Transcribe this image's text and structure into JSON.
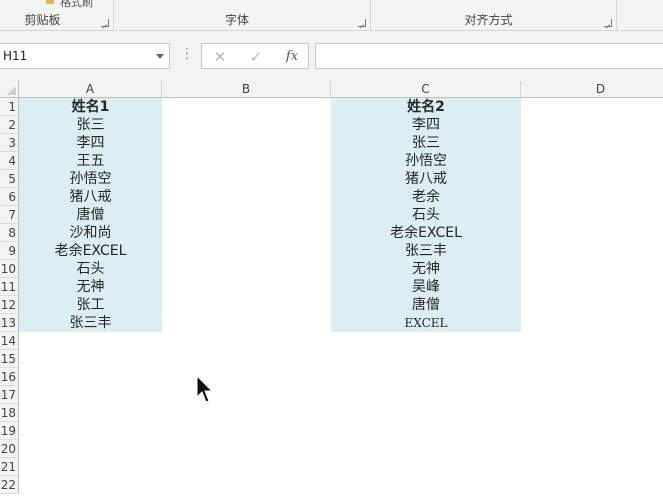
{
  "ribbon": {
    "format_painter_label": "格式刷",
    "groups": [
      {
        "label": "剪贴板"
      },
      {
        "label": "字体"
      },
      {
        "label": "对齐方式"
      }
    ]
  },
  "formula_bar": {
    "name_box": "H11",
    "cancel_icon": "✕",
    "enter_icon": "✓",
    "fx_label": "fx",
    "formula_value": ""
  },
  "sheet": {
    "columns": [
      "A",
      "B",
      "C",
      "D"
    ],
    "rows": [
      "1",
      "2",
      "3",
      "4",
      "5",
      "6",
      "7",
      "8",
      "9",
      "10",
      "11",
      "12",
      "13",
      "14",
      "15",
      "16",
      "17",
      "18",
      "19",
      "20",
      "21",
      "22"
    ],
    "column_a": [
      "姓名1",
      "张三",
      "李四",
      "王五",
      "孙悟空",
      "猪八戒",
      "唐僧",
      "沙和尚",
      "老余EXCEL",
      "石头",
      "无神",
      "张工",
      "张三丰"
    ],
    "column_c": [
      "姓名2",
      "李四",
      "张三",
      "孙悟空",
      "猪八戒",
      "老余",
      "石头",
      "老余EXCEL",
      "张三丰",
      "无神",
      "吴峰",
      "唐僧",
      "EXCEL"
    ],
    "highlight_color": "#daeef3"
  }
}
